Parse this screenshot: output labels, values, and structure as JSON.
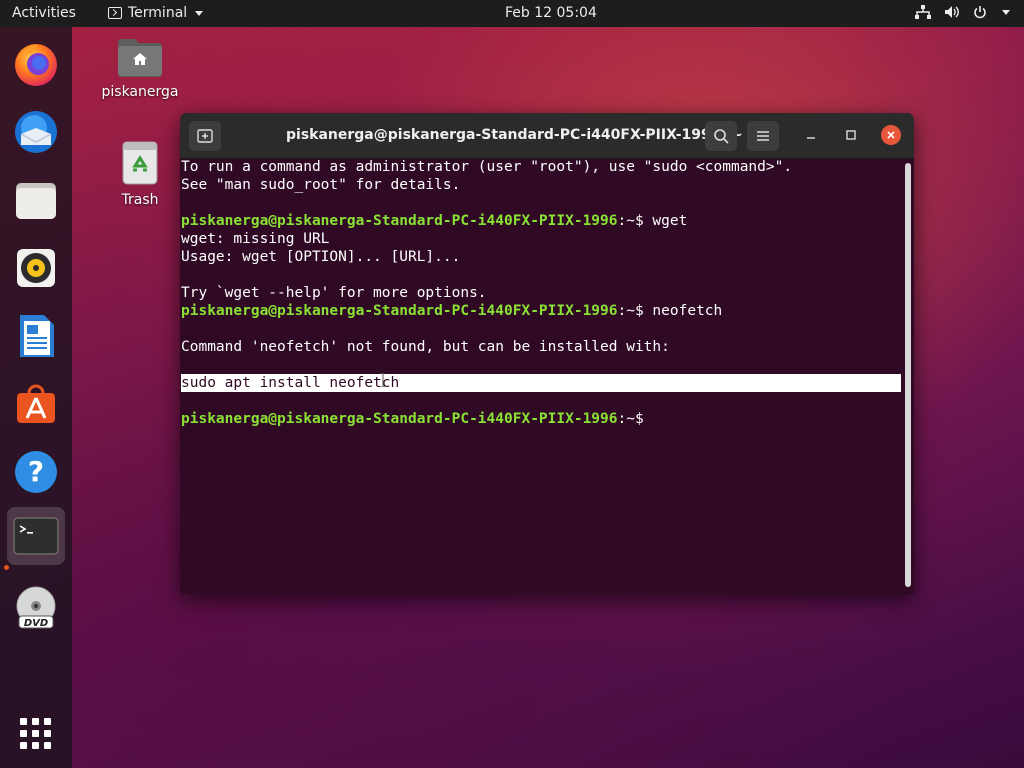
{
  "topbar": {
    "activities": "Activities",
    "app_menu": "Terminal",
    "clock": "Feb 12  05:04"
  },
  "dock": {
    "items": [
      {
        "name": "Firefox"
      },
      {
        "name": "Thunderbird"
      },
      {
        "name": "Files"
      },
      {
        "name": "Rhythmbox"
      },
      {
        "name": "LibreOffice Writer"
      },
      {
        "name": "Ubuntu Software"
      },
      {
        "name": "Help"
      },
      {
        "name": "Terminal"
      },
      {
        "name": "DVD"
      },
      {
        "name": "Show Applications"
      }
    ],
    "dvd_label": "DVD"
  },
  "desktop": {
    "home_label": "piskanerga",
    "trash_label": "Trash"
  },
  "terminal": {
    "title": "piskanerga@piskanerga-Standard-PC-i440FX-PIIX-1996: ~",
    "prompt_user": "piskanerga@piskanerga-Standard-PC-i440FX-PIIX-1996",
    "prompt_suffix": ":~$",
    "lines": {
      "l1": "To run a command as administrator (user \"root\"), use \"sudo <command>\".",
      "l2": "See \"man sudo_root\" for details.",
      "cmd1": " wget",
      "l4": "wget: missing URL",
      "l5": "Usage: wget [OPTION]... [URL]...",
      "l7": "Try `wget --help' for more options.",
      "cmd2": " neofetch",
      "l10": "Command 'neofetch' not found, but can be installed with:",
      "l12": "sudo apt install neofetch"
    }
  },
  "colors": {
    "terminal_bg": "#300a24",
    "prompt": "#8ae234",
    "accent": "#e95420"
  }
}
